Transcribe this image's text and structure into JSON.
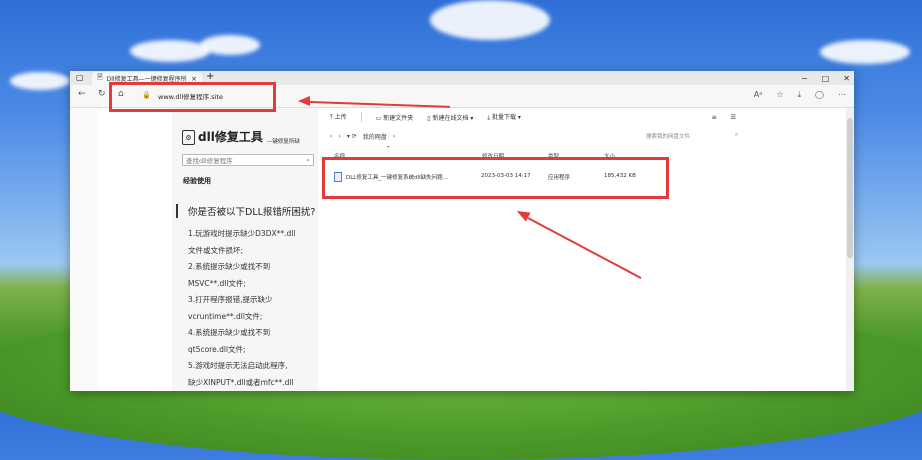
{
  "browser": {
    "tab_title": "Dll修复工具—一键修复程序所缺C",
    "url": "www.dll修复程序.site",
    "window_controls": [
      "−",
      "□",
      "✕"
    ],
    "nav_icons": [
      "back-icon",
      "refresh-icon",
      "home-icon",
      "lock-icon"
    ],
    "right_icons": [
      "read-aloud-icon",
      "favorites-icon",
      "download-icon",
      "profile-icon",
      "more-icon"
    ]
  },
  "panel": {
    "brand": "dll修复工具",
    "brand_sub": "—键修复所缺",
    "search_placeholder": "查找dll修复程序",
    "experience_label": "经验使用",
    "question": "你是否被以下DLL报错所困扰?",
    "issues": [
      "1.玩游戏时提示缺少D3DX**.dll",
      "文件或文件损坏;",
      "2.系统提示缺少或找不到",
      "MSVC**.dll文件;",
      "3.打开程序报错,提示缺少",
      "vcruntime**.dll文件;",
      "4.系统提示缺少或找不到",
      "qt5core.dll文件;",
      "5.游戏时提示无法启动此程序,",
      "缺少XINPUT*.dll或者mfc**.dll"
    ]
  },
  "file_manager": {
    "toolbar": {
      "upload": "上传",
      "new_folder": "新建文件夹",
      "new_doc": "新建在线文档",
      "batch_download": "批量下载"
    },
    "path": "我的网盘",
    "search_placeholder": "搜索我的网盘文件",
    "columns": [
      "名称",
      "修改日期",
      "类型",
      "大小"
    ],
    "files": [
      {
        "name": "DLL修复工具_一键修复系统dll缺失问题...",
        "date": "2023-03-03 14:17",
        "type": "应用程序",
        "size": "185,432 KB"
      }
    ]
  },
  "annotations": {
    "highlight_color": "#e23b3b"
  }
}
